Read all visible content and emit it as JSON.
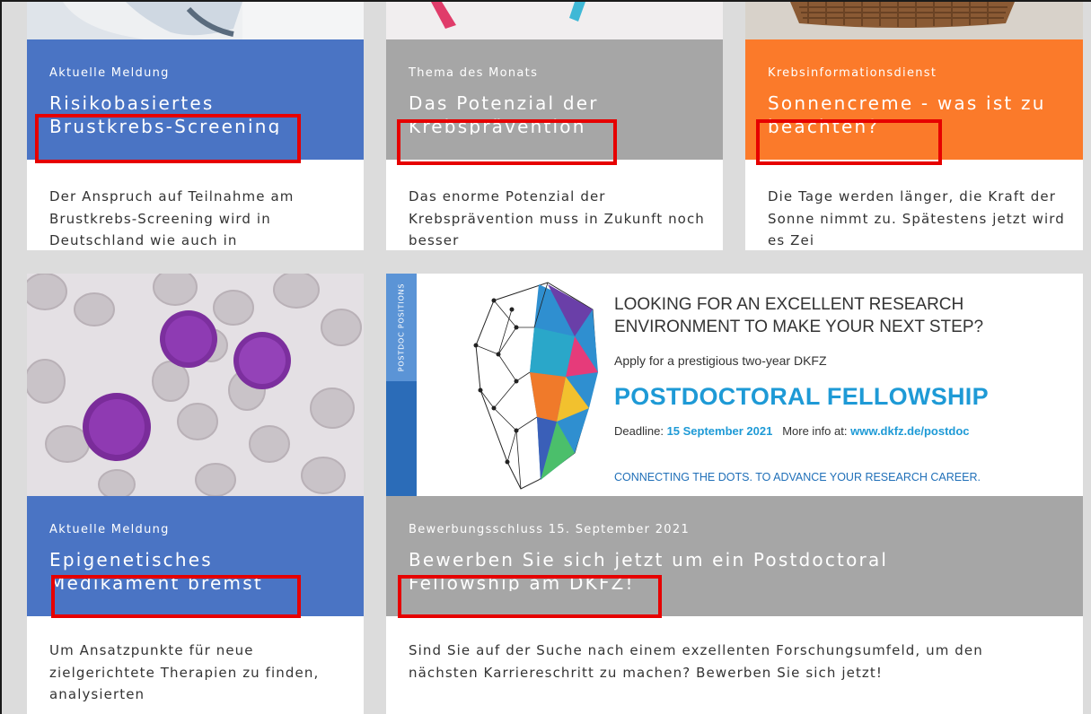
{
  "cards": [
    {
      "kicker": "Aktuelle Meldung",
      "headline": "Risikobasiertes Brustkrebs-Screening",
      "teaser": "Der Anspruch auf Teilnahme am Brustkrebs-Screening wird in Deutschland wie auch in",
      "image": "medical-photo"
    },
    {
      "kicker": "Thema des Monats",
      "headline": "Das Potenzial der Krebsprävention",
      "teaser": "Das enorme Potenzial der Krebsprävention muss in Zukunft noch besser",
      "image": "ribbon-photo"
    },
    {
      "kicker": "Krebsinformationsdienst",
      "headline": "Sonnencreme - was ist zu beachten?",
      "teaser": "Die Tage werden länger, die Kraft der Sonne nimmt zu. Spätestens jetzt wird es Zei",
      "image": "basket-photo"
    },
    {
      "kicker": "Aktuelle Meldung",
      "headline": "Epigenetisches Medikament bremst",
      "teaser": "Um Ansatzpunkte für neue zielgerichtete Therapien zu finden, analysierten",
      "image": "blood-cells-micrograph"
    },
    {
      "kicker": "Bewerbungsschluss 15. September 2021",
      "headline": "Bewerben Sie sich jetzt um ein Postdoctoral Fellowship am DKFZ!",
      "teaser": "Sind Sie auf der Suche nach einem exzellenten Forschungsumfeld, um den nächsten Karriereschritt zu machen? Bewerben Sie sich jetzt!",
      "image": "postdoc-banner"
    }
  ],
  "ad": {
    "vertical_label": "POSTDOC POSITIONS",
    "title": "LOOKING FOR AN EXCELLENT RESEARCH ENVIRONMENT TO MAKE YOUR NEXT STEP?",
    "subtitle": "Apply for a prestigious two-year DKFZ",
    "headline": "POSTDOCTORAL FELLOWSHIP",
    "deadline_label": "Deadline:",
    "deadline_date": "15 September 2021",
    "more_info_label": "More info at:",
    "url": "www.dkfz.de/postdoc",
    "tagline": "CONNECTING THE DOTS. TO ADVANCE YOUR RESEARCH CAREER."
  },
  "colors": {
    "blue_band": "#4a74c4",
    "grey_band": "#a6a6a6",
    "orange_band": "#fb7a2a",
    "highlight": "#e60000",
    "ad_accent": "#1e9ad6"
  }
}
